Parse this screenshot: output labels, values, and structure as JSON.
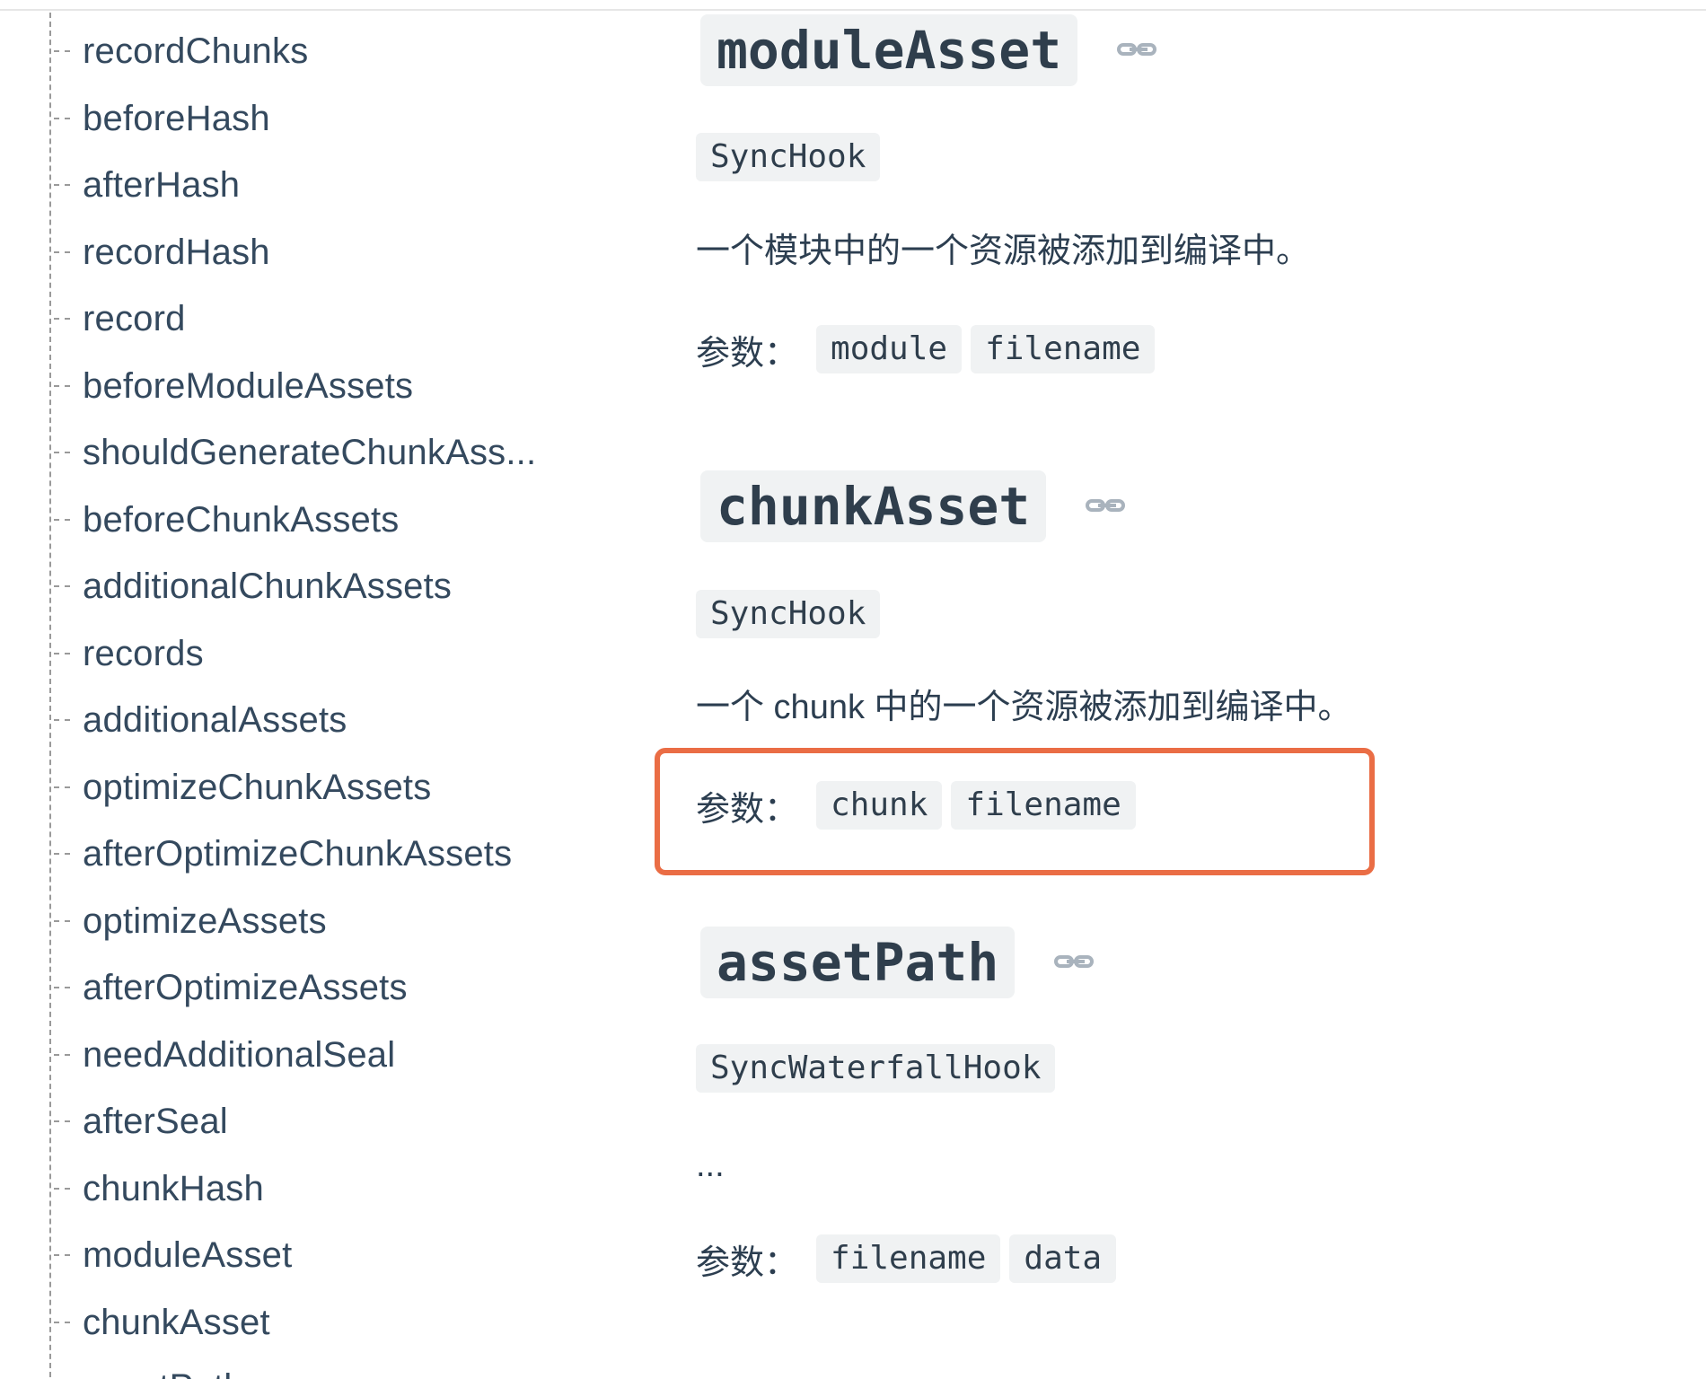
{
  "sidebar": {
    "items": [
      {
        "label": "recordChunks"
      },
      {
        "label": "beforeHash"
      },
      {
        "label": "afterHash"
      },
      {
        "label": "recordHash"
      },
      {
        "label": "record"
      },
      {
        "label": "beforeModuleAssets"
      },
      {
        "label": "shouldGenerateChunkAss..."
      },
      {
        "label": "beforeChunkAssets"
      },
      {
        "label": "additionalChunkAssets"
      },
      {
        "label": "records"
      },
      {
        "label": "additionalAssets"
      },
      {
        "label": "optimizeChunkAssets"
      },
      {
        "label": "afterOptimizeChunkAssets"
      },
      {
        "label": "optimizeAssets"
      },
      {
        "label": "afterOptimizeAssets"
      },
      {
        "label": "needAdditionalSeal"
      },
      {
        "label": "afterSeal"
      },
      {
        "label": "chunkHash"
      },
      {
        "label": "moduleAsset"
      },
      {
        "label": "chunkAsset"
      },
      {
        "label": "assetPath"
      }
    ]
  },
  "sections": [
    {
      "title": "moduleAsset",
      "hook_type": "SyncHook",
      "description": "一个模块中的一个资源被添加到编译中。",
      "params_label": "参数：",
      "params": [
        "module",
        "filename"
      ]
    },
    {
      "title": "chunkAsset",
      "hook_type": "SyncHook",
      "description": "一个 chunk 中的一个资源被添加到编译中。",
      "params_label": "参数：",
      "params": [
        "chunk",
        "filename"
      ]
    },
    {
      "title": "assetPath",
      "hook_type": "SyncWaterfallHook",
      "description": "...",
      "params_label": "参数：",
      "params": [
        "filename",
        "data"
      ]
    }
  ],
  "colors": {
    "highlight_border": "#ea6d45",
    "code_background": "#f0f2f3",
    "text": "#2c3e50"
  },
  "icons": {
    "anchor": "link-icon"
  }
}
